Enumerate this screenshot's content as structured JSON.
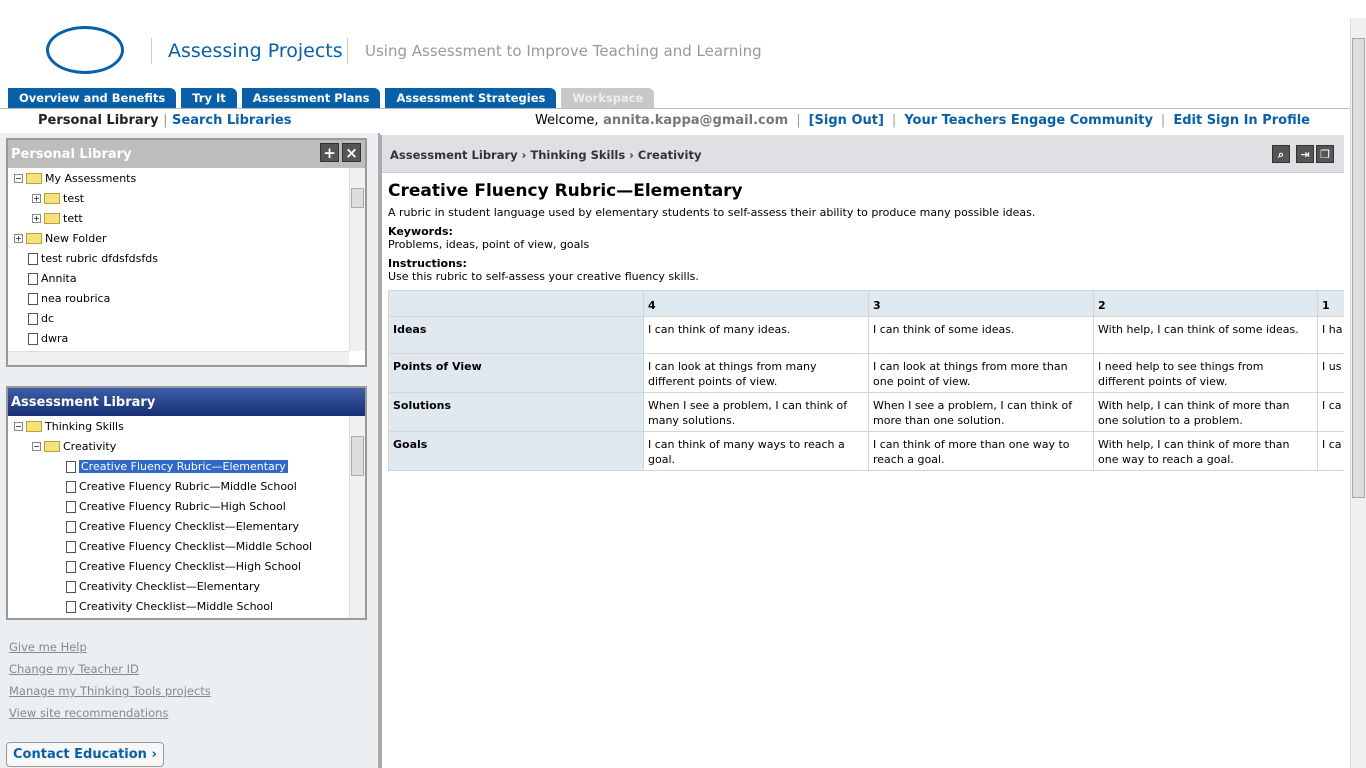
{
  "header": {
    "logo": "intel",
    "title": "Assessing Projects",
    "subtitle": "Using Assessment to Improve Teaching and Learning"
  },
  "tabs": [
    {
      "label": "Overview and Benefits"
    },
    {
      "label": "Try It"
    },
    {
      "label": "Assessment Plans"
    },
    {
      "label": "Assessment Strategies"
    },
    {
      "label": "Workspace",
      "disabled": true
    }
  ],
  "subnav": {
    "personal": "Personal Library",
    "search": "Search Libraries"
  },
  "user": {
    "welcome": "Welcome,",
    "email": "annita.kappa@gmail.com",
    "signout": "[Sign Out]",
    "community": "Your Teachers Engage Community",
    "profile": "Edit Sign In Profile",
    "sep": "|"
  },
  "personal_library": {
    "title": "Personal Library",
    "items": [
      {
        "label": "My Assessments",
        "type": "folder"
      },
      {
        "label": "test",
        "type": "folder"
      },
      {
        "label": "tett",
        "type": "folder"
      },
      {
        "label": "New Folder",
        "type": "folder"
      },
      {
        "label": "test  rubric dfdsfdsfds",
        "type": "doc"
      },
      {
        "label": "Annita",
        "type": "doc"
      },
      {
        "label": "nea roubrica",
        "type": "doc"
      },
      {
        "label": "dc",
        "type": "doc"
      },
      {
        "label": "dwra",
        "type": "doc"
      }
    ]
  },
  "assessment_library": {
    "title": "Assessment Library",
    "items": [
      {
        "label": "Thinking Skills",
        "type": "folder"
      },
      {
        "label": "Creativity",
        "type": "folder"
      },
      {
        "label": "Creative Fluency Rubric—Elementary",
        "selected": true
      },
      {
        "label": "Creative Fluency Rubric—Middle School"
      },
      {
        "label": "Creative Fluency Rubric—High School"
      },
      {
        "label": "Creative Fluency Checklist—Elementary"
      },
      {
        "label": "Creative Fluency Checklist—Middle School"
      },
      {
        "label": "Creative Fluency Checklist—High School"
      },
      {
        "label": "Creativity Checklist—Elementary"
      },
      {
        "label": "Creativity Checklist—Middle School"
      }
    ]
  },
  "links": [
    "Give me Help",
    "Change my Teacher ID",
    "Manage my Thinking Tools projects",
    "View site recommendations"
  ],
  "contact": "Contact Education ›",
  "main": {
    "breadcrumb": "Assessment Library › Thinking Skills › Creativity",
    "title": "Creative Fluency Rubric—Elementary",
    "description": "A rubric in student language used by elementary students to self-assess their ability to produce many possible ideas.",
    "keywords_label": "Keywords:",
    "keywords": "Problems, ideas, point of view, goals",
    "instructions_label": "Instructions:",
    "instructions": "Use this rubric to self-assess your creative fluency skills.",
    "table": {
      "headers": [
        "",
        "4",
        "3",
        "2",
        "1"
      ],
      "rows": [
        [
          "Ideas",
          "I can think of many ideas.",
          "I can think of some ideas.",
          "With help, I can think of some ideas.",
          "I ha"
        ],
        [
          "Points of View",
          "I can look at things from many different points of view.",
          "I can look at things from more than one point of view.",
          "I need help to see things from different points of view.",
          "I us one"
        ],
        [
          "Solutions",
          "When I see a problem, I can think of many solutions.",
          "When I see a problem, I can think of more than one solution.",
          "With help, I can think of more than one solution to a problem.",
          "I ca solu"
        ],
        [
          "Goals",
          "I can think of many ways to reach a goal.",
          "I can think of more than one way to reach a goal.",
          "With help, I can think of more than one way to reach a goal.",
          "I ca reac"
        ]
      ]
    }
  }
}
